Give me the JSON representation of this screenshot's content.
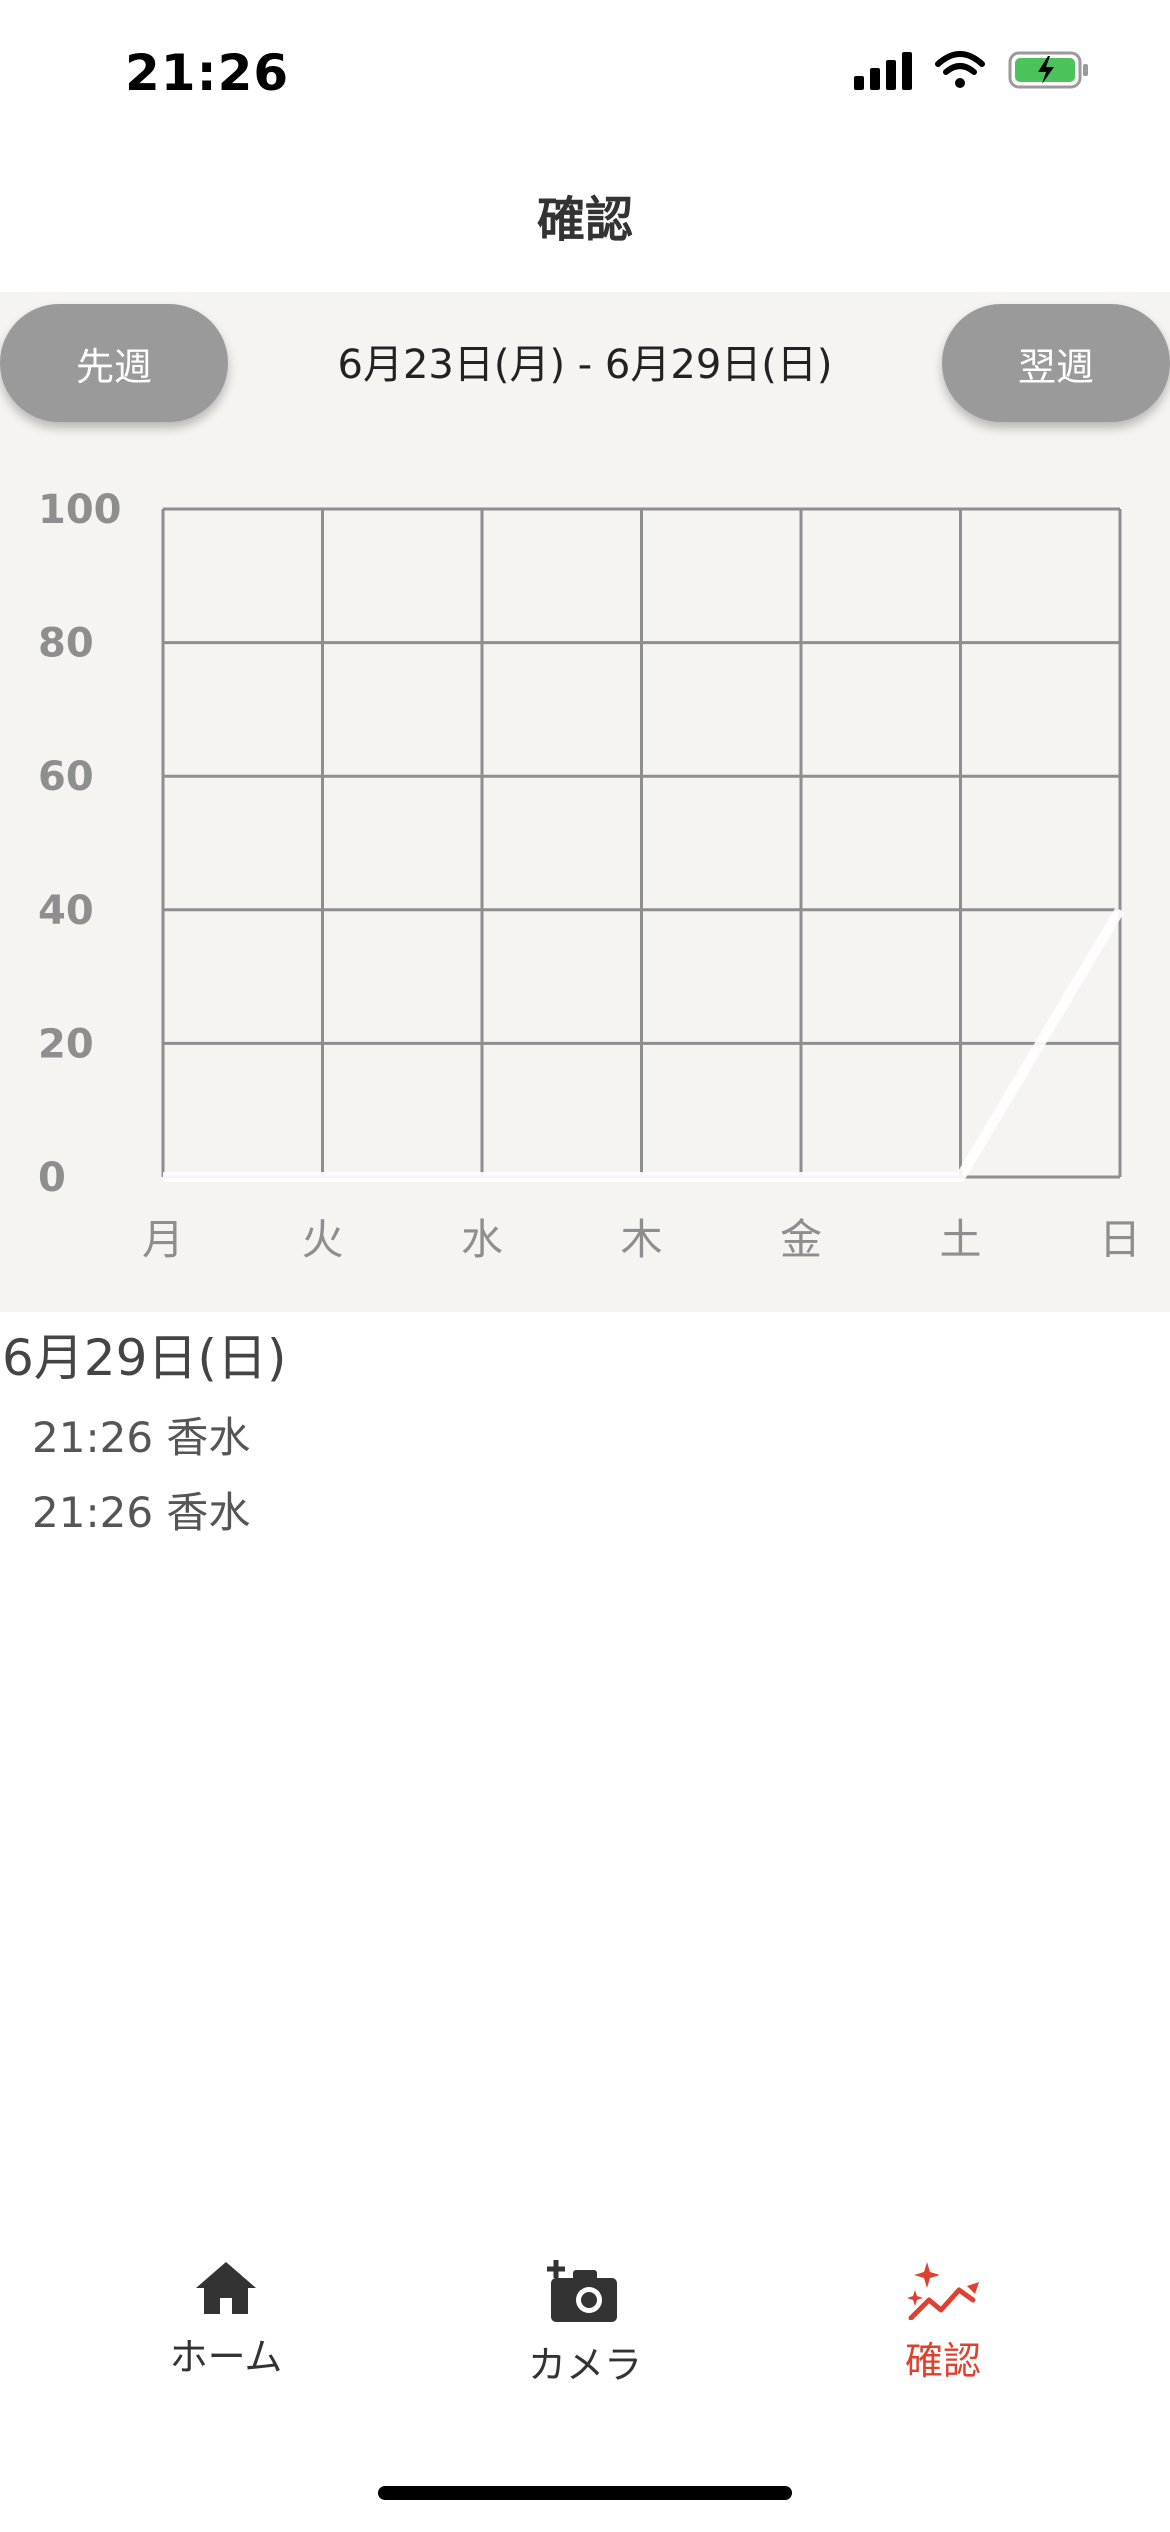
{
  "status_bar": {
    "time": "21:26"
  },
  "nav": {
    "title": "確認"
  },
  "week": {
    "prev_label": "先週",
    "next_label": "翌週",
    "range": "6月23日(月) - 6月29日(日)"
  },
  "chart_data": {
    "type": "line",
    "categories": [
      "月",
      "火",
      "水",
      "木",
      "金",
      "土",
      "日"
    ],
    "values": [
      0,
      0,
      0,
      0,
      0,
      0,
      40
    ],
    "yticks": [
      "0",
      "20",
      "40",
      "60",
      "80",
      "100"
    ],
    "ylim": [
      0,
      100
    ],
    "grid": true,
    "line_color": "#ffffff"
  },
  "log": {
    "date": "6月29日(日)",
    "items": [
      "21:26 香水",
      "21:26 香水"
    ]
  },
  "tabs": {
    "home": "ホーム",
    "camera": "カメラ",
    "confirm": "確認"
  },
  "colors": {
    "accent": "#e0402f",
    "panel": "#f5f4f0",
    "button": "#9a9a9a"
  }
}
